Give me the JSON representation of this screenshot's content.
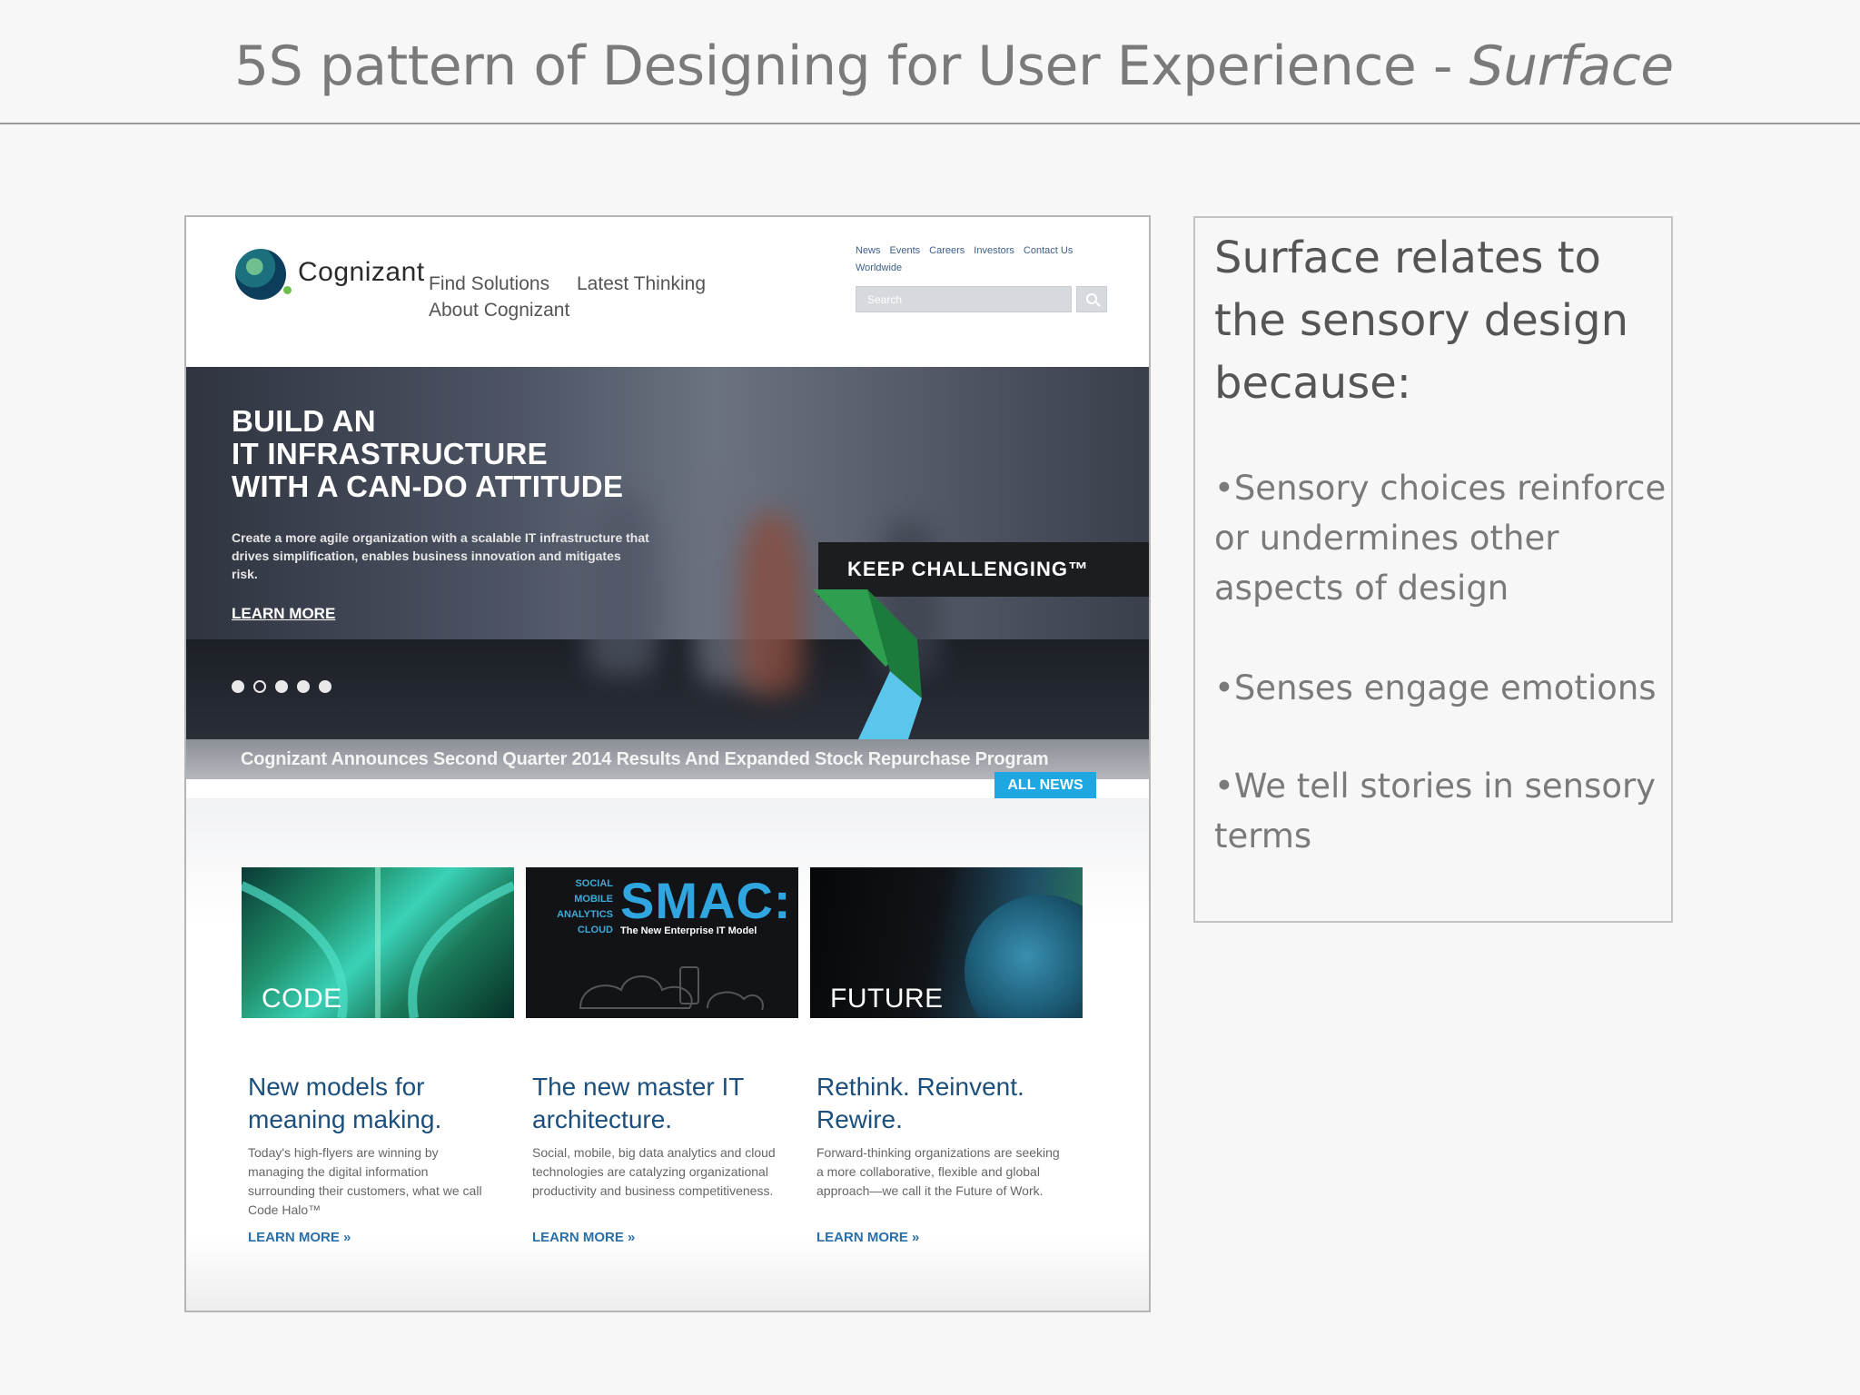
{
  "slide": {
    "title_main": "5S pattern of Designing for User Experience - ",
    "title_emphasis": "Surface"
  },
  "site": {
    "logo_text": "Cognizant",
    "nav": [
      "Find Solutions",
      "Latest Thinking",
      "About Cognizant"
    ],
    "utility_links": [
      "News",
      "Events",
      "Careers",
      "Investors",
      "Contact Us",
      "Worldwide"
    ],
    "search_placeholder": "Search",
    "hero": {
      "headline": [
        "BUILD AN",
        "IT INFRASTRUCTURE",
        "WITH A CAN-DO ATTITUDE"
      ],
      "body": "Create a more agile organization with a scalable IT infrastructure that drives simplification, enables business innovation and mitigates risk.",
      "cta": "LEARN MORE",
      "tagline": "KEEP CHALLENGING™",
      "slide_count": 5
    },
    "news_headline": "Cognizant Announces Second Quarter 2014 Results And Expanded Stock Repurchase Program",
    "all_news": "ALL NEWS",
    "tiles": [
      {
        "label": "CODE"
      },
      {
        "side_lines": [
          "SOCIAL",
          "MOBILE",
          "ANALYTICS",
          "CLOUD"
        ],
        "big": "SMAC:",
        "sub": "The New Enterprise IT Model"
      },
      {
        "label": "FUTURE"
      }
    ],
    "articles": [
      {
        "title": [
          "New models for",
          "meaning making."
        ],
        "body": "Today's high-flyers are winning by managing the digital information surrounding their customers, what we call Code Halo™",
        "more": "LEARN MORE »"
      },
      {
        "title": [
          "The new master IT",
          "architecture."
        ],
        "body": "Social, mobile, big data analytics and cloud technologies are catalyzing organizational productivity and business competitiveness.",
        "more": "LEARN MORE »"
      },
      {
        "title": [
          "Rethink. Reinvent.",
          "Rewire."
        ],
        "body": "Forward-thinking organizations are seeking a more collaborative, flexible and global approach—we call it the Future of Work.",
        "more": "LEARN MORE »"
      }
    ]
  },
  "note": {
    "heading": "Surface relates to the sensory design because:",
    "bullets": [
      "•Sensory choices reinforce or undermines other aspects of design",
      "•Senses engage emotions",
      "•We tell stories in sensory terms"
    ]
  }
}
